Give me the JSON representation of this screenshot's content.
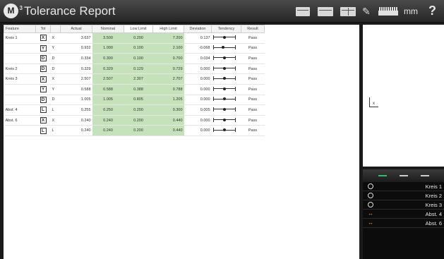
{
  "app": {
    "logo_text": "M",
    "logo_sup": "3",
    "title": "Tolerance Report"
  },
  "toolbar": {
    "unit": "mm",
    "help": "?"
  },
  "report": {
    "columns": [
      "Feature",
      "Tol",
      "",
      "Actual",
      "Nominal",
      "Low Limit",
      "High Limit",
      "Deviation",
      "Tendency",
      "Result"
    ],
    "rows": [
      {
        "feature": "Kreis 1",
        "tol": "X",
        "axis": "X",
        "actual": "3.637",
        "nominal": "3.500",
        "low": "0.200",
        "high": "7.200",
        "dev": "0.137",
        "tendency": 0.52,
        "result": "Pass"
      },
      {
        "feature": "",
        "tol": "Y",
        "axis": "Y",
        "actual": "0.932",
        "nominal": "1.000",
        "low": "0.100",
        "high": "2.100",
        "dev": "-0.068",
        "tendency": 0.45,
        "result": "Pass"
      },
      {
        "feature": "",
        "tol": "D",
        "axis": "D",
        "actual": "0.334",
        "nominal": "0.300",
        "low": "0.100",
        "high": "0.700",
        "dev": "0.034",
        "tendency": 0.5,
        "result": "Pass"
      },
      {
        "feature": "Kreis 2",
        "tol": "D",
        "axis": "D",
        "actual": "0.329",
        "nominal": "0.329",
        "low": "0.129",
        "high": "0.729",
        "dev": "0.000",
        "tendency": 0.5,
        "result": "Pass"
      },
      {
        "feature": "Kreis 3",
        "tol": "X",
        "axis": "X",
        "actual": "2.507",
        "nominal": "2.507",
        "low": "2.307",
        "high": "2.707",
        "dev": "0.000",
        "tendency": 0.5,
        "result": "Pass"
      },
      {
        "feature": "",
        "tol": "Y",
        "axis": "Y",
        "actual": "0.588",
        "nominal": "0.588",
        "low": "0.388",
        "high": "0.788",
        "dev": "0.000",
        "tendency": 0.5,
        "result": "Pass"
      },
      {
        "feature": "",
        "tol": "D",
        "axis": "D",
        "actual": "1.005",
        "nominal": "1.005",
        "low": "0.805",
        "high": "1.205",
        "dev": "0.000",
        "tendency": 0.5,
        "result": "Pass"
      },
      {
        "feature": "Abst. 4",
        "tol": "L",
        "axis": "L",
        "actual": "0.255",
        "nominal": "0.250",
        "low": "0.200",
        "high": "0.300",
        "dev": "0.005",
        "tendency": 0.52,
        "result": "Pass"
      },
      {
        "feature": "Abst. 6",
        "tol": "X",
        "axis": "X",
        "actual": "0.240",
        "nominal": "0.240",
        "low": "0.200",
        "high": "0.440",
        "dev": "0.000",
        "tendency": 0.5,
        "result": "Pass"
      },
      {
        "feature": "",
        "tol": "L",
        "axis": "L",
        "actual": "0.240",
        "nominal": "0.240",
        "low": "0.200",
        "high": "0.440",
        "dev": "0.000",
        "tendency": 0.5,
        "result": "Pass"
      }
    ]
  },
  "viewport": {
    "axis_label": "x"
  },
  "features": {
    "items": [
      {
        "icon": "circle-icon",
        "name": "Kreis 1"
      },
      {
        "icon": "circle-icon",
        "name": "Kreis 2"
      },
      {
        "icon": "circle-icon",
        "name": "Kreis 3"
      },
      {
        "icon": "distance-icon",
        "name": "Abst. 4"
      },
      {
        "icon": "distance-icon",
        "name": "Abst. 6"
      }
    ]
  },
  "colors": {
    "accent": "#44b26a",
    "nominal_bg": "#c6e2ba",
    "distance_icon": "#e0a030"
  }
}
